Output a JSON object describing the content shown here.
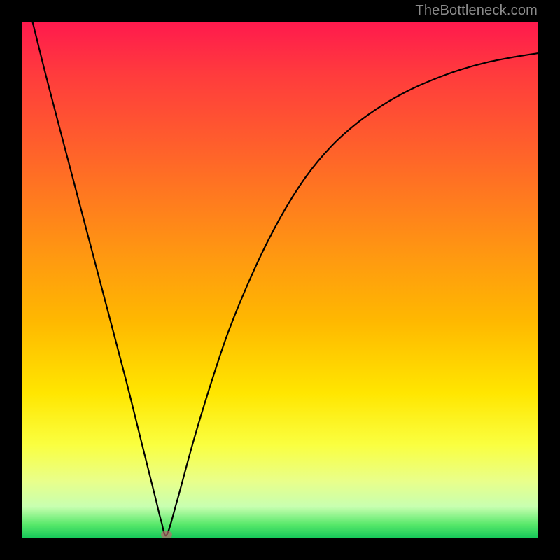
{
  "attribution": "TheBottleneck.com",
  "chart_data": {
    "type": "line",
    "title": "",
    "xlabel": "",
    "ylabel": "",
    "xlim": [
      0,
      100
    ],
    "ylim": [
      0,
      100
    ],
    "series": [
      {
        "name": "bottleneck-curve",
        "x": [
          2,
          5,
          10,
          15,
          20,
          23,
          25,
          26,
          27,
          28,
          30,
          33,
          36,
          40,
          45,
          50,
          55,
          60,
          65,
          70,
          75,
          80,
          85,
          90,
          95,
          100
        ],
        "values": [
          100,
          88,
          69,
          50,
          31,
          19,
          11,
          7,
          3,
          0.5,
          7,
          18,
          28,
          40,
          52,
          62,
          70,
          76,
          80.5,
          84,
          86.8,
          89,
          90.8,
          92.2,
          93.2,
          94
        ]
      }
    ],
    "marker": {
      "x": 28,
      "y": 0.5
    },
    "background_gradient_stops": [
      {
        "pos": 0.0,
        "color": "#ff1a4d"
      },
      {
        "pos": 0.1,
        "color": "#ff3b3d"
      },
      {
        "pos": 0.22,
        "color": "#ff5a2e"
      },
      {
        "pos": 0.34,
        "color": "#ff7a1f"
      },
      {
        "pos": 0.46,
        "color": "#ff9a10"
      },
      {
        "pos": 0.58,
        "color": "#ffb800"
      },
      {
        "pos": 0.72,
        "color": "#ffe600"
      },
      {
        "pos": 0.82,
        "color": "#faff40"
      },
      {
        "pos": 0.89,
        "color": "#e9ff8a"
      },
      {
        "pos": 0.94,
        "color": "#c8ffb0"
      },
      {
        "pos": 0.975,
        "color": "#57e86a"
      },
      {
        "pos": 1.0,
        "color": "#18c95a"
      }
    ]
  }
}
